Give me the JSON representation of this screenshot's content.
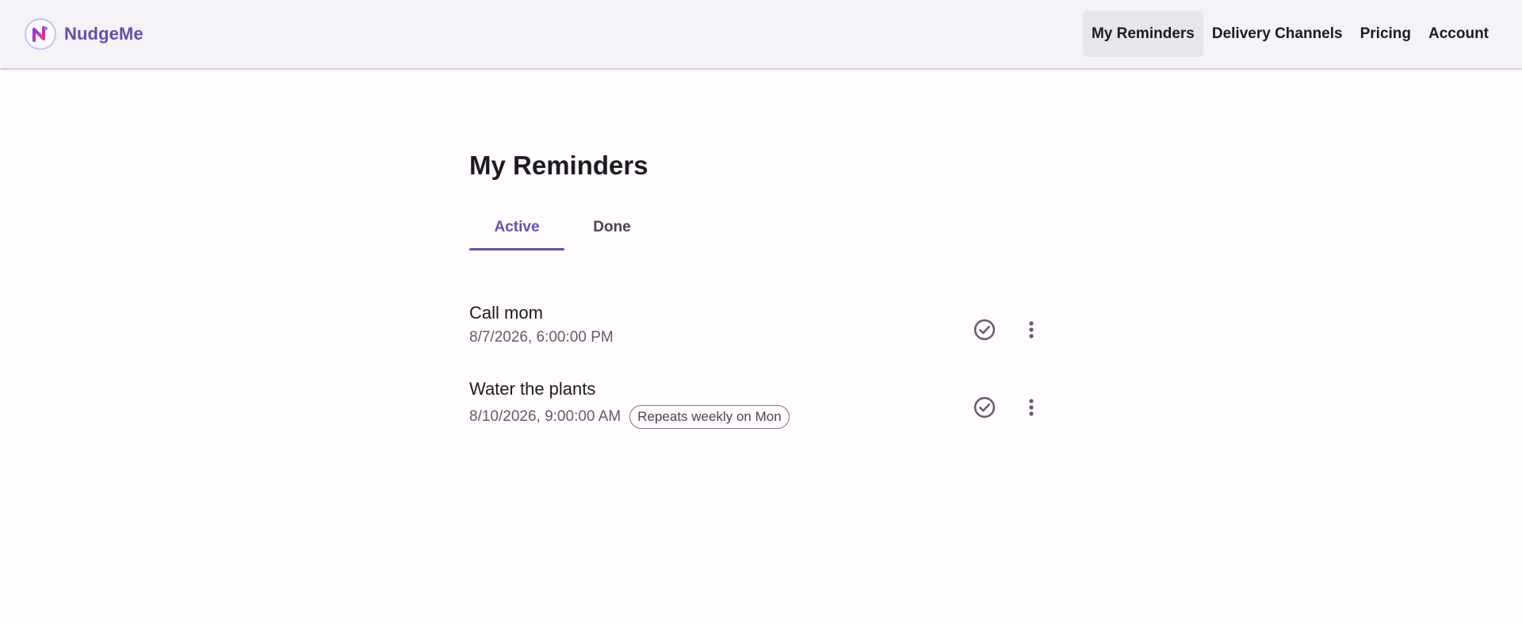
{
  "app": {
    "name": "NudgeMe"
  },
  "nav": {
    "items": [
      {
        "label": "My Reminders",
        "active": true
      },
      {
        "label": "Delivery Channels",
        "active": false
      },
      {
        "label": "Pricing",
        "active": false
      },
      {
        "label": "Account",
        "active": false
      }
    ]
  },
  "page": {
    "title": "My Reminders"
  },
  "tabs": [
    {
      "label": "Active",
      "active": true
    },
    {
      "label": "Done",
      "active": false
    }
  ],
  "reminders": [
    {
      "title": "Call mom",
      "datetime": "8/7/2026, 6:00:00 PM",
      "repeat": ""
    },
    {
      "title": "Water the plants",
      "datetime": "8/10/2026, 9:00:00 AM",
      "repeat": "Repeats weekly on Mon"
    }
  ],
  "colors": {
    "primary": "#6750a4",
    "appbar": "#f5f2f8",
    "background": "#fffbfe",
    "icon": "#605d66"
  },
  "icons": {
    "complete": "check-circle-icon",
    "menu": "more-vert-icon",
    "logo": "nudgeme-logo-icon"
  }
}
